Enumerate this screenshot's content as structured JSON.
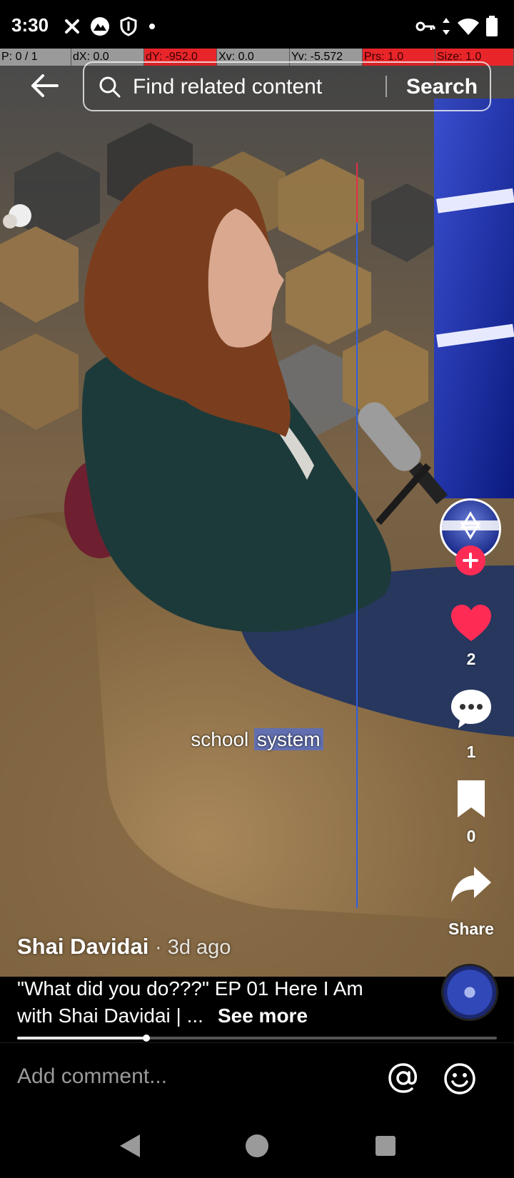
{
  "status_bar": {
    "time": "3:30",
    "left_icons": [
      "close-x-icon",
      "app-notification-icon",
      "shield-icon",
      "dot-icon"
    ],
    "right_icons": [
      "vpn-key-icon",
      "data-arrows-icon",
      "wifi-icon",
      "battery-icon"
    ]
  },
  "debug": {
    "p": "P: 0 / 1",
    "dx": "dX: 0.0",
    "dy": "dY: -952.0",
    "xv": "Xv: 0.0",
    "yv": "Yv: -5.572",
    "prs": "Prs: 1.0",
    "size": "Size: 1.0"
  },
  "search": {
    "placeholder": "Find related content",
    "button_label": "Search"
  },
  "video": {
    "caption_plain": "school",
    "caption_highlight": "system"
  },
  "actions": {
    "like_count": "2",
    "comment_count": "1",
    "bookmark_count": "0",
    "share_label": "Share"
  },
  "post": {
    "author": "Shai Davidai",
    "age": "· 3d ago",
    "description": "\"What did you do???\" EP 01 Here I Am with Shai Davidai | ...",
    "see_more": "See more",
    "progress": 0.27
  },
  "comment_bar": {
    "placeholder": "Add comment..."
  },
  "colors": {
    "accent": "#fe2c55",
    "caption_highlight": "#506ed2",
    "debug_red": "#e8262a"
  }
}
